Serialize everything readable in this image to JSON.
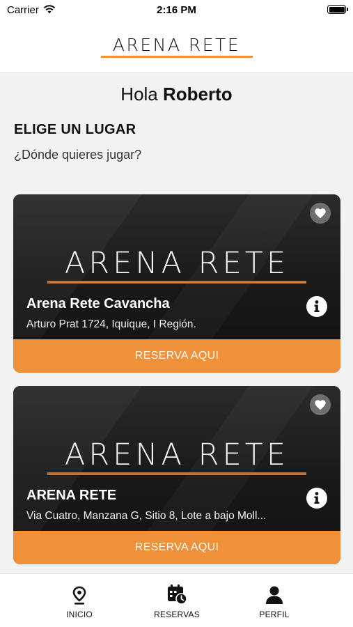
{
  "status_bar": {
    "carrier": "Carrier",
    "time": "2:16 PM"
  },
  "header": {
    "logo_text": "ARENA RETE"
  },
  "greeting": {
    "prefix": "Hola",
    "name": "Roberto"
  },
  "section": {
    "title": "ELIGE UN LUGAR",
    "subtitle": "¿Dónde quieres jugar?"
  },
  "venues": [
    {
      "logo_text": "ARENA RETE",
      "name": "Arena Rete Cavancha",
      "address": "Arturo Prat 1724, Iquique, I Región.",
      "reserve_label": "RESERVA AQUI"
    },
    {
      "logo_text": "ARENA RETE",
      "name": "ARENA RETE",
      "address": "Via Cuatro, Manzana G, Sitio 8, Lote a bajo Moll...",
      "reserve_label": "RESERVA AQUI"
    }
  ],
  "tabs": [
    {
      "label": "INICIO",
      "icon": "location-pin-icon"
    },
    {
      "label": "RESERVAS",
      "icon": "calendar-clock-icon"
    },
    {
      "label": "PERFIL",
      "icon": "user-icon"
    }
  ],
  "colors": {
    "accent": "#f0913a",
    "card_bg": "#1e1e1e",
    "background": "#f2f2f2"
  }
}
